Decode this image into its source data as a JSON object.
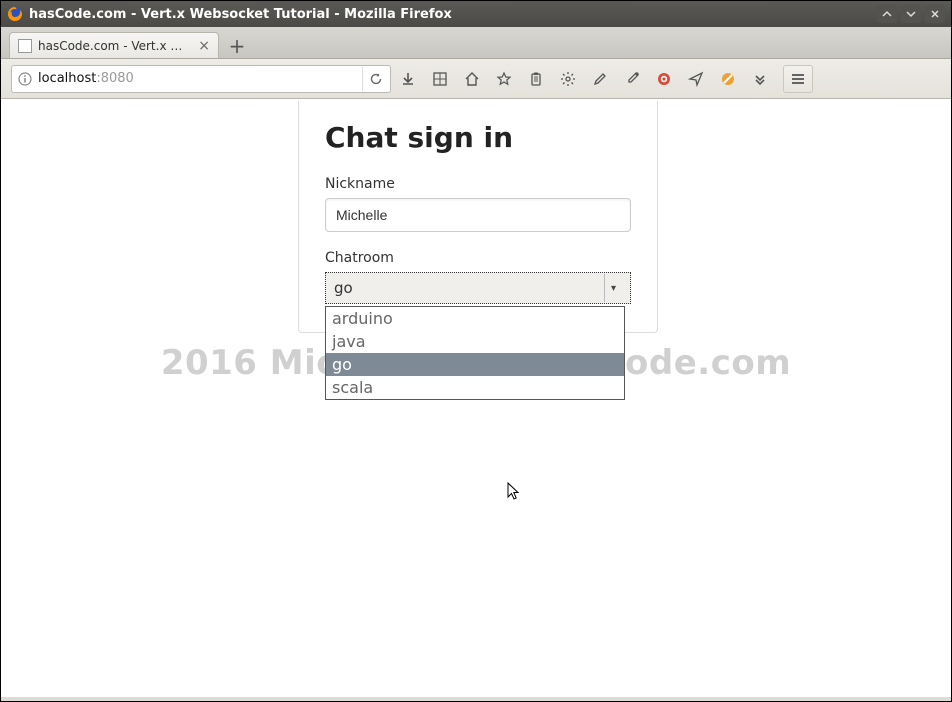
{
  "window": {
    "title": "hasCode.com - Vert.x Websocket Tutorial - Mozilla Firefox"
  },
  "tabstrip": {
    "tab_title": "hasCode.com - Vert.x W...",
    "newtab_tooltip": "Open a new tab"
  },
  "navbar": {
    "url_host": "localhost",
    "url_port": ":8080",
    "icons": {
      "download": "download-icon",
      "tile": "tile-view-icon",
      "home": "home-icon",
      "star": "bookmark-star-icon",
      "clipboard": "clipboard-icon",
      "gear": "gear-icon",
      "pencil": "pencil-icon",
      "eyedrop": "eyedropper-icon",
      "red": "adblock-icon",
      "plane": "send-icon",
      "noscript": "noscript-icon",
      "overflow": "overflow-icon"
    }
  },
  "page": {
    "heading": "Chat sign in",
    "nickname_label": "Nickname",
    "nickname_value": "Michelle",
    "chatroom_label": "Chatroom",
    "chatroom_selected": "go",
    "chatroom_options": [
      "arduino",
      "java",
      "go",
      "scala"
    ],
    "watermark": "2016 Micha Kops / hasCode.com"
  }
}
